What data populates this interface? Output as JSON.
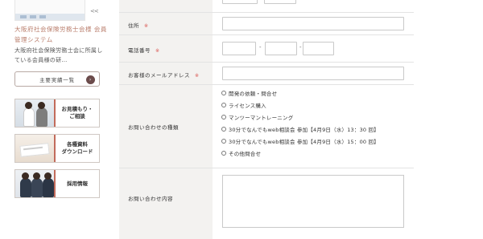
{
  "sidebar": {
    "logo_arrows": "<<",
    "org_name": "大阪府社会保険労務士会様 会員管理システム",
    "org_desc": "大阪府社会保険労務士会に所属している会員様の研…",
    "list_button": "主要実績一覧",
    "list_button_icon": "arrow-right-icon",
    "banners": [
      {
        "label_line1": "お見積もり・",
        "label_line2": "ご相談"
      },
      {
        "label_line1": "各種資料",
        "label_line2": "ダウンロード"
      },
      {
        "label_line1": "採用情報",
        "label_line2": ""
      }
    ]
  },
  "form": {
    "address_label": "住所",
    "phone_label": "電話番号",
    "email_label": "お客様のメールアドレス",
    "inquiry_type_label": "お問い合わせの種類",
    "inquiry_content_label": "お問い合わせ内容",
    "required_mark": "※",
    "phone_separator": "-",
    "address_value": "",
    "email_value": "",
    "phone_values": [
      "",
      "",
      ""
    ],
    "inquiry_options": [
      "開発の依頼・問合せ",
      "ライセンス購入",
      "マンツーマントレーニング",
      "30分でなんでもweb相談会 参加【4月9日（水）13：30 回】",
      "30分でなんでもweb相談会 参加【4月9日（水）15：00 回】",
      "その他問合せ"
    ],
    "inquiry_content_value": ""
  }
}
